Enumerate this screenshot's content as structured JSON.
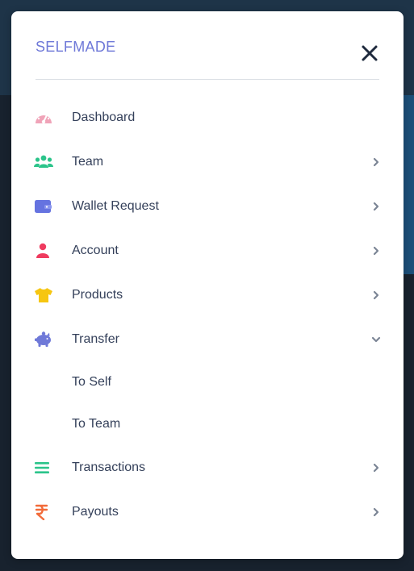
{
  "header": {
    "brand": "SELFMADE",
    "close_icon": "close-icon"
  },
  "colors": {
    "brand": "#6f79d8",
    "text": "#34405a",
    "dashboard_icon": "#f0a3b8",
    "team_icon": "#2bc48a",
    "wallet_icon": "#6573e0",
    "account_icon": "#ef3b5f",
    "products_icon": "#f6c611",
    "transfer_icon": "#6f79d8",
    "transactions_icon": "#2bc48a",
    "payouts_icon": "#f26b3a"
  },
  "menu": {
    "items": [
      {
        "label": "Dashboard",
        "icon": "speedometer-icon",
        "has_chevron": false
      },
      {
        "label": "Team",
        "icon": "users-icon",
        "has_chevron": true
      },
      {
        "label": "Wallet Request",
        "icon": "wallet-icon",
        "has_chevron": true
      },
      {
        "label": "Account",
        "icon": "user-icon",
        "has_chevron": true
      },
      {
        "label": "Products",
        "icon": "tshirt-icon",
        "has_chevron": true
      },
      {
        "label": "Transfer",
        "icon": "piggy-bank-icon",
        "has_chevron": true,
        "expanded": true
      },
      {
        "label": "Transactions",
        "icon": "list-icon",
        "has_chevron": true
      },
      {
        "label": "Payouts",
        "icon": "rupee-icon",
        "has_chevron": true
      }
    ],
    "transfer_subitems": [
      {
        "label": "To Self"
      },
      {
        "label": "To Team"
      }
    ]
  }
}
